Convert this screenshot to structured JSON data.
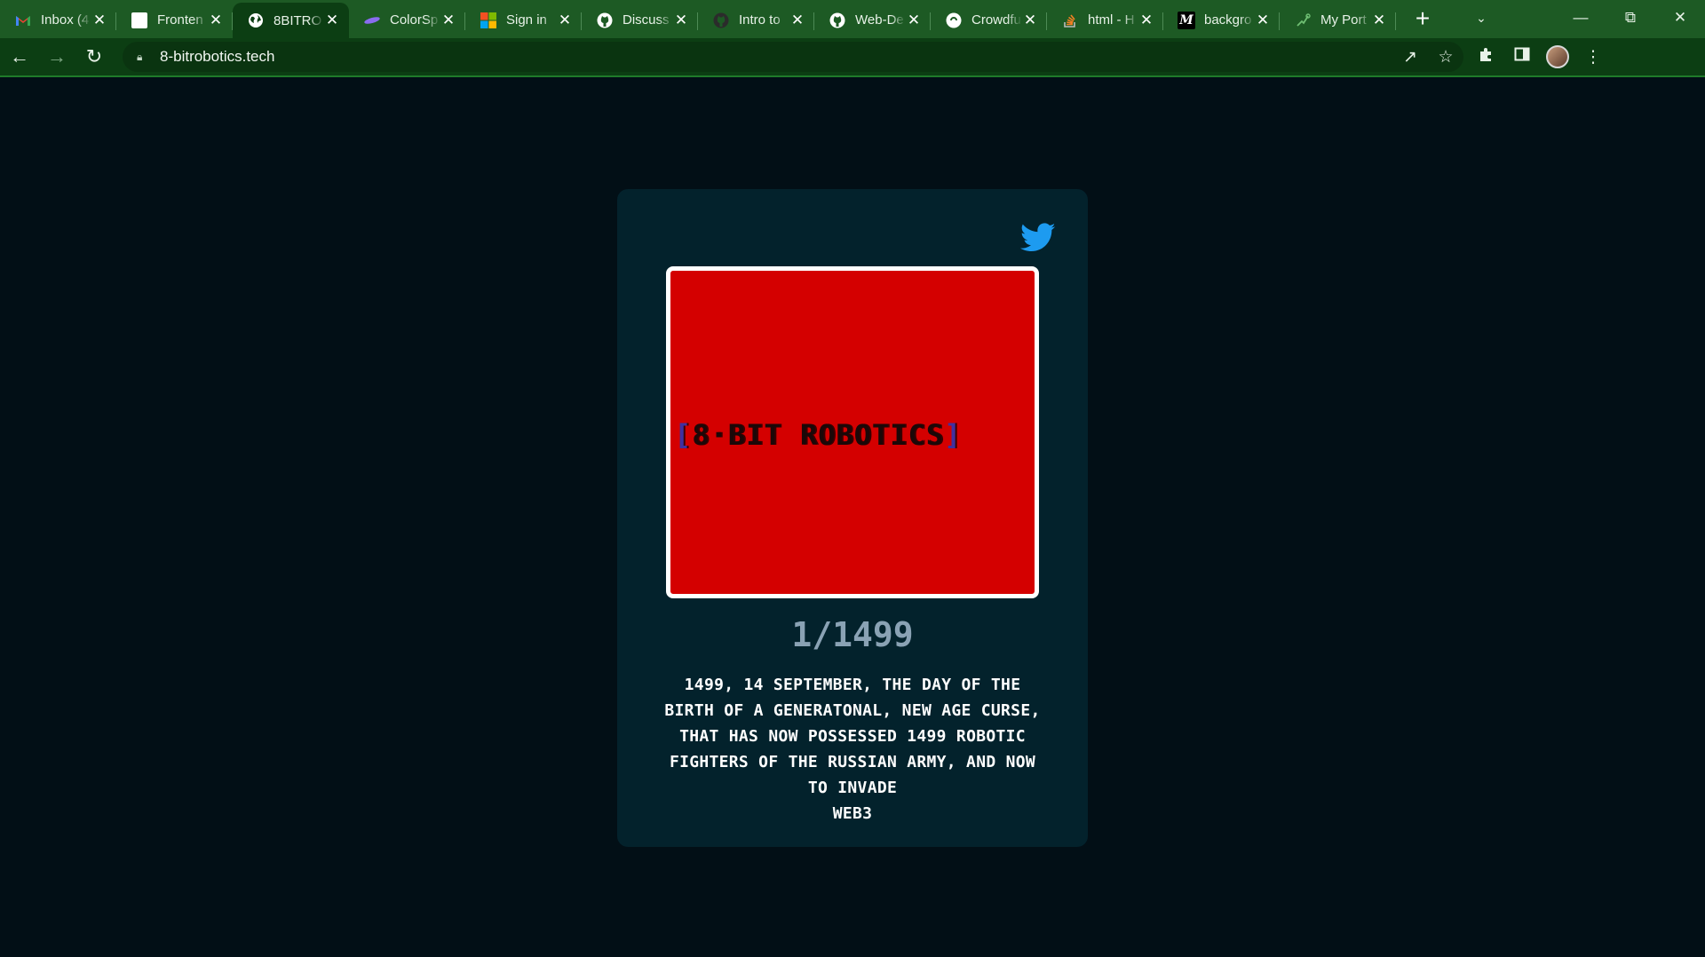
{
  "browser": {
    "tabs": [
      {
        "title": "Inbox (4",
        "favicon": "gmail-icon",
        "active": false
      },
      {
        "title": "Fronten",
        "favicon": "frontend-mentor-icon",
        "active": false
      },
      {
        "title": "8BITRO",
        "favicon": "globe-icon",
        "active": true
      },
      {
        "title": "ColorSp",
        "favicon": "colorspace-icon",
        "active": false
      },
      {
        "title": "Sign in",
        "favicon": "microsoft-icon",
        "active": false
      },
      {
        "title": "Discuss",
        "favicon": "github-icon",
        "active": false
      },
      {
        "title": "Intro to",
        "favicon": "github-icon",
        "active": false
      },
      {
        "title": "Web-De",
        "favicon": "github-icon",
        "active": false
      },
      {
        "title": "Crowdfu",
        "favicon": "frontend-mentor-icon",
        "active": false
      },
      {
        "title": "html - H",
        "favicon": "stackoverflow-icon",
        "active": false
      },
      {
        "title": "backgro",
        "favicon": "medium-icon",
        "active": false
      },
      {
        "title": "My Port",
        "favicon": "portfolio-icon",
        "active": false
      }
    ],
    "url": "8-bitrobotics.tech"
  },
  "colors": {
    "page_background": "#020f16",
    "card_background": "#03222c",
    "nft_background": "#d40000",
    "counter_color": "#8aa2b4",
    "twitter_blue": "#1d9bf0",
    "browser_frame": "#1d5a24"
  },
  "card": {
    "twitter_icon": "twitter-bird-icon",
    "nft_logo_text": "8·BIT ROBOTICS",
    "counter": "1/1499",
    "description_lines": [
      "1499, 14 SEPTEMBER, THE DAY OF THE",
      "BIRTH OF A GENERATONAL, NEW AGE CURSE,",
      "THAT HAS NOW POSSESSED 1499 ROBOTIC",
      "FIGHTERS OF THE RUSSIAN ARMY, AND NOW",
      "TO INVADE",
      "WEB3"
    ]
  }
}
